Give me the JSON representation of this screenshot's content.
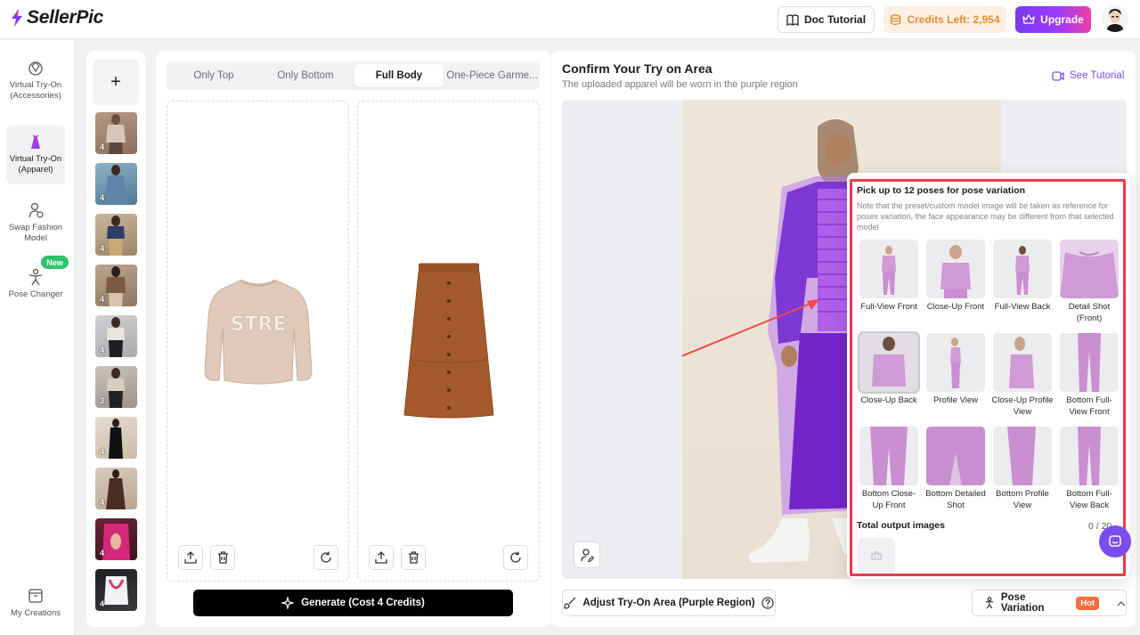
{
  "header": {
    "app_name": "SellerPic",
    "doc_tutorial": "Doc Tutorial",
    "credits": "Credits Left: 2,954",
    "upgrade": "Upgrade"
  },
  "nav": {
    "items": [
      {
        "label": "Virtual Try-On (Accessories)"
      },
      {
        "label": "Virtual Try-On (Apparel)"
      },
      {
        "label": "Swap Fashion Model"
      },
      {
        "label": "Pose Changer"
      }
    ],
    "new_badge": "New",
    "my_creations": "My Creations"
  },
  "thumbs": {
    "add": "+",
    "counts": [
      "4",
      "4",
      "4",
      "4",
      "4",
      "3",
      "4",
      "4",
      "4",
      "4"
    ]
  },
  "tabs": [
    {
      "label": "Only Top"
    },
    {
      "label": "Only Bottom"
    },
    {
      "label": "Full Body"
    },
    {
      "label": "One-Piece Garme..."
    }
  ],
  "generate": "Generate (Cost 4 Credits)",
  "right": {
    "title": "Confirm Your Try on Area",
    "subtitle": "The uploaded apparel will be worn in the purple region",
    "see_tutorial": "See Tutorial",
    "adjust": "Adjust Try-On Area (Purple Region)",
    "pose_variation": "Pose Variation",
    "hot": "Hot"
  },
  "popover": {
    "title": "Pick up to 12 poses for pose variation",
    "note": "Note that the preset/custom model image will be taken as reference for poses variation, the face appearance may be different from that selected model",
    "poses": [
      {
        "label": "Full-View Front"
      },
      {
        "label": "Close-Up Front"
      },
      {
        "label": "Full-View Back"
      },
      {
        "label": "Detail Shot (Front)"
      },
      {
        "label": "Close-Up Back"
      },
      {
        "label": "Profile View"
      },
      {
        "label": "Close-Up Profile View"
      },
      {
        "label": "Bottom Full-View Front"
      },
      {
        "label": "Bottom Close-Up Front"
      },
      {
        "label": "Bottom Detailed Shot"
      },
      {
        "label": "Bottom Profile View"
      },
      {
        "label": "Bottom Full-View Back"
      }
    ],
    "total_label": "Total output images",
    "total_value": "0 / 20"
  },
  "colors": {
    "accent": "#7c4cf0",
    "highlight_box": "#e83b4c",
    "credits_text": "#ef8a2f",
    "tryon_region": "#8b3ee6"
  }
}
